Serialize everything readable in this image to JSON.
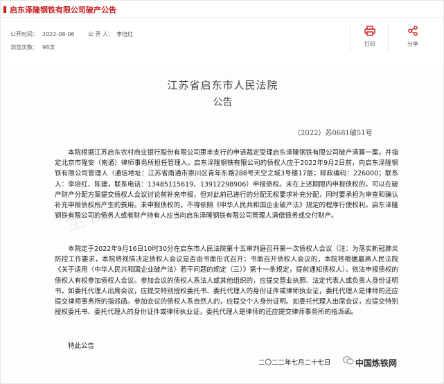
{
  "header": {
    "title": "启东泽隆钢铁有限公司破产公告"
  },
  "meta": {
    "publish_label": "公开时间：",
    "publish_date": "2022-08-06",
    "publisher_label": "公 开 人：",
    "publisher": "李培红",
    "views_label": "浏览次数：",
    "views": "98次"
  },
  "actions": {
    "print_label": "打印",
    "share_label": "分享"
  },
  "document": {
    "court": "江苏省启东市人民法院",
    "doc_type": "公告",
    "case_number": "（2022）苏0681破51号",
    "paragraphs": [
      "本院根据江苏启东农村商业银行股份有限公司惠丰支行的申请裁定受理启东泽隆钢铁有限公司破产清算一案，并指定北京市隆安（南通）律师事务所担任管理人。启东泽隆钢铁有限公司的债权人应于2022年9月2日前，向启东泽隆钢铁有限公司管理人（通信地址：江苏省南通市崇川区青年东路288号天空之城3号楼17层；邮政编码：226000；联系人：李培红、陈建，联系电话：13485115619、13912298906）申报债权。未在上述期限内申报债权的，可以在破产财产分配方案提交债权人会议讨论前补充申报，但对此前已进行的分配无权要求补充分配，同时要承担为审查和确认补充申报债权所产生的费用。未申报债权的，不得依照《中华人民共和国企业破产法》规定的程序行使权利。启东泽隆钢铁有限公司的债务人或者财产持有人应当向启东泽隆钢铁有限公司管理人清偿债务或交付财产。",
      "本院定于2022年9月16日10时30分在启东市人民法院第十五审判庭召开第一次债权人会议（注：为落实新冠肺炎防控工作要求，本院将视情决定债权人会议是否由书面形式召开；书面召开债权人会议的，本院将根据最高人民法院《关于适用〈中华人民共和国企业破产法〉若干问题的规定（三）》第十一条规定，提前通知债权人）。依法申报债权的债权人有权参加债权人会议。参加会议的债权人系法人或其他组织的，应提交营业执照、法定代表人或负责人身份证明书，如委托代理人出席会议，应提交特别授权委托书、委托代理人的身份证件或律师执业证，委托代理人是律师的还应提交律师事务所的指派函。参加会议的债权人系自然人的，应提交个人身份证明。如委托代理人出席会议，应提交特别授权委托书、委托代理人的身份证件或律师执业证，委托代理人是律师的还应提交律师事务所的指派函。"
    ],
    "closing": "特此公告",
    "date": "二〇二二年七月二十七日"
  },
  "watermark": {
    "text": "全国企业破产重整"
  },
  "brand": {
    "name": "中国炼铁网"
  },
  "colors": {
    "accent": "#c81c1c"
  }
}
